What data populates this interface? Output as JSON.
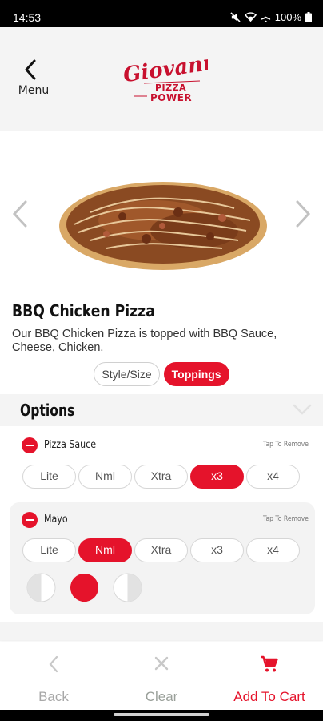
{
  "status_bar": {
    "time": "14:53",
    "battery": "100%"
  },
  "header": {
    "back_label": "Menu",
    "logo_text": "Giovanni's",
    "logo_sub": "PIZZA POWER"
  },
  "product": {
    "title": "BBQ Chicken Pizza",
    "description": "Our BBQ Chicken Pizza is topped with BBQ Sauce, Cheese, Chicken."
  },
  "tabs": [
    {
      "label": "Style/Size",
      "active": false
    },
    {
      "label": "Toppings",
      "active": true
    }
  ],
  "options": {
    "title": "Options",
    "items": [
      {
        "name": "Pizza Sauce",
        "hint": "Tap To Remove",
        "amounts": [
          "Lite",
          "Nml",
          "Xtra",
          "x3",
          "x4"
        ],
        "selected": "x3"
      },
      {
        "name": "Mayo",
        "hint": "Tap To Remove",
        "amounts": [
          "Lite",
          "Nml",
          "Xtra",
          "x3",
          "x4"
        ],
        "selected": "Nml",
        "portion": "whole"
      }
    ]
  },
  "bottom_bar": {
    "back": "Back",
    "clear": "Clear",
    "add_to_cart": "Add To Cart"
  },
  "colors": {
    "accent": "#e5132b",
    "header_bg": "#f4f4f4"
  }
}
